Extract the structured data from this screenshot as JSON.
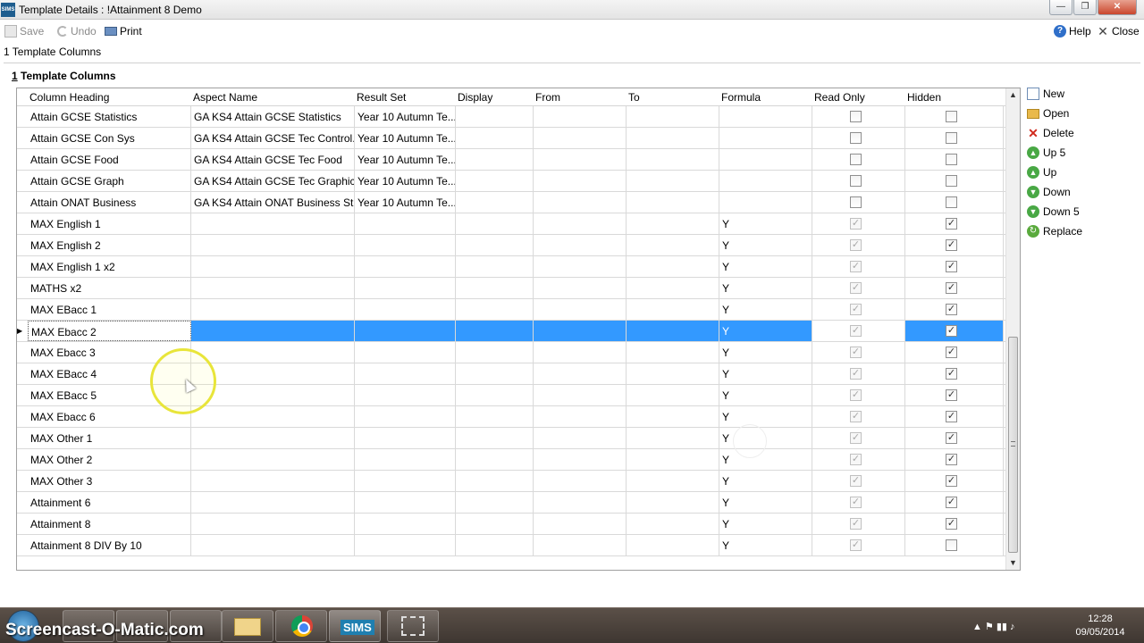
{
  "window": {
    "title": "Template Details : !Attainment 8 Demo",
    "app_icon_label": "SIMS",
    "min_glyph": "—",
    "max_glyph": "❐",
    "close_glyph": "✕"
  },
  "toolbar": {
    "save_label": "Save",
    "undo_label": "Undo",
    "print_label": "Print",
    "help_label": "Help",
    "close_label": "Close"
  },
  "breadcrumb": "1 Template Columns",
  "section": {
    "number": "1",
    "title": "Template Columns"
  },
  "grid": {
    "columns": [
      "Column Heading",
      "Aspect Name",
      "Result Set",
      "Display",
      "From",
      "To",
      "Formula",
      "Read Only",
      "Hidden"
    ],
    "rows": [
      {
        "heading": "Attain GCSE Statistics",
        "aspect": "GA KS4 Attain GCSE Statistics",
        "result_set": "Year 10 Autumn Te...",
        "display": "",
        "from": "",
        "to": "",
        "formula": "",
        "read_only": false,
        "read_only_disabled": false,
        "hidden": false
      },
      {
        "heading": "Attain GCSE Con Sys",
        "aspect": "GA KS4 Attain GCSE Tec Control...",
        "result_set": "Year 10 Autumn Te...",
        "display": "",
        "from": "",
        "to": "",
        "formula": "",
        "read_only": false,
        "read_only_disabled": false,
        "hidden": false
      },
      {
        "heading": "Attain GCSE Food",
        "aspect": "GA KS4 Attain GCSE Tec Food",
        "result_set": "Year 10 Autumn Te...",
        "display": "",
        "from": "",
        "to": "",
        "formula": "",
        "read_only": false,
        "read_only_disabled": false,
        "hidden": false
      },
      {
        "heading": "Attain GCSE Graph",
        "aspect": "GA KS4 Attain GCSE Tec Graphics",
        "result_set": "Year 10 Autumn Te...",
        "display": "",
        "from": "",
        "to": "",
        "formula": "",
        "read_only": false,
        "read_only_disabled": false,
        "hidden": false
      },
      {
        "heading": "Attain ONAT Business",
        "aspect": "GA KS4 Attain ONAT Business St",
        "result_set": "Year 10 Autumn Te...",
        "display": "",
        "from": "",
        "to": "",
        "formula": "",
        "read_only": false,
        "read_only_disabled": false,
        "hidden": false
      },
      {
        "heading": "MAX English 1",
        "aspect": "",
        "result_set": "",
        "display": "",
        "from": "",
        "to": "",
        "formula": "Y",
        "read_only": true,
        "read_only_disabled": true,
        "hidden": true
      },
      {
        "heading": "MAX English 2",
        "aspect": "",
        "result_set": "",
        "display": "",
        "from": "",
        "to": "",
        "formula": "Y",
        "read_only": true,
        "read_only_disabled": true,
        "hidden": true
      },
      {
        "heading": "MAX English 1 x2",
        "aspect": "",
        "result_set": "",
        "display": "",
        "from": "",
        "to": "",
        "formula": "Y",
        "read_only": true,
        "read_only_disabled": true,
        "hidden": true
      },
      {
        "heading": "MATHS x2",
        "aspect": "",
        "result_set": "",
        "display": "",
        "from": "",
        "to": "",
        "formula": "Y",
        "read_only": true,
        "read_only_disabled": true,
        "hidden": true
      },
      {
        "heading": "MAX EBacc 1",
        "aspect": "",
        "result_set": "",
        "display": "",
        "from": "",
        "to": "",
        "formula": "Y",
        "read_only": true,
        "read_only_disabled": true,
        "hidden": true
      },
      {
        "heading": "MAX Ebacc 2",
        "aspect": "",
        "result_set": "",
        "display": "",
        "from": "",
        "to": "",
        "formula": "Y",
        "read_only": true,
        "read_only_disabled": true,
        "hidden": true,
        "selected": true
      },
      {
        "heading": "MAX Ebacc 3",
        "aspect": "",
        "result_set": "",
        "display": "",
        "from": "",
        "to": "",
        "formula": "Y",
        "read_only": true,
        "read_only_disabled": true,
        "hidden": true
      },
      {
        "heading": "MAX EBacc 4",
        "aspect": "",
        "result_set": "",
        "display": "",
        "from": "",
        "to": "",
        "formula": "Y",
        "read_only": true,
        "read_only_disabled": true,
        "hidden": true
      },
      {
        "heading": "MAX EBacc 5",
        "aspect": "",
        "result_set": "",
        "display": "",
        "from": "",
        "to": "",
        "formula": "Y",
        "read_only": true,
        "read_only_disabled": true,
        "hidden": true
      },
      {
        "heading": "MAX Ebacc 6",
        "aspect": "",
        "result_set": "",
        "display": "",
        "from": "",
        "to": "",
        "formula": "Y",
        "read_only": true,
        "read_only_disabled": true,
        "hidden": true
      },
      {
        "heading": "MAX Other 1",
        "aspect": "",
        "result_set": "",
        "display": "",
        "from": "",
        "to": "",
        "formula": "Y",
        "read_only": true,
        "read_only_disabled": true,
        "hidden": true
      },
      {
        "heading": "MAX Other 2",
        "aspect": "",
        "result_set": "",
        "display": "",
        "from": "",
        "to": "",
        "formula": "Y",
        "read_only": true,
        "read_only_disabled": true,
        "hidden": true
      },
      {
        "heading": "MAX Other 3",
        "aspect": "",
        "result_set": "",
        "display": "",
        "from": "",
        "to": "",
        "formula": "Y",
        "read_only": true,
        "read_only_disabled": true,
        "hidden": true
      },
      {
        "heading": "Attainment 6",
        "aspect": "",
        "result_set": "",
        "display": "",
        "from": "",
        "to": "",
        "formula": "Y",
        "read_only": true,
        "read_only_disabled": true,
        "hidden": true
      },
      {
        "heading": "Attainment 8",
        "aspect": "",
        "result_set": "",
        "display": "",
        "from": "",
        "to": "",
        "formula": "Y",
        "read_only": true,
        "read_only_disabled": true,
        "hidden": true
      },
      {
        "heading": "Attainment 8 DIV By 10",
        "aspect": "",
        "result_set": "",
        "display": "",
        "from": "",
        "to": "",
        "formula": "Y",
        "read_only": true,
        "read_only_disabled": true,
        "hidden": false
      }
    ],
    "scroll_up_glyph": "▲",
    "scroll_down_glyph": "▼",
    "row_pointer_glyph": "▶",
    "check_glyph": "✓"
  },
  "actions": [
    {
      "label": "New",
      "icon": "new-document-icon"
    },
    {
      "label": "Open",
      "icon": "open-folder-icon"
    },
    {
      "label": "Delete",
      "icon": "delete-x-icon"
    },
    {
      "label": "Up 5",
      "icon": "up-5-arrow-icon"
    },
    {
      "label": "Up",
      "icon": "up-arrow-icon"
    },
    {
      "label": "Down",
      "icon": "down-arrow-icon"
    },
    {
      "label": "Down 5",
      "icon": "down-5-arrow-icon"
    },
    {
      "label": "Replace",
      "icon": "replace-icon"
    }
  ],
  "taskbar": {
    "watermark": "Screencast-O-Matic.com",
    "sims_label": "SIMS",
    "time": "12:28",
    "date": "09/05/2014",
    "tray_glyphs": "▲  ⚑  ▮▮  ♪"
  },
  "colors": {
    "selection": "#3399ff",
    "grid_line": "#d9d9d9",
    "taskbar": "#4a403a"
  }
}
